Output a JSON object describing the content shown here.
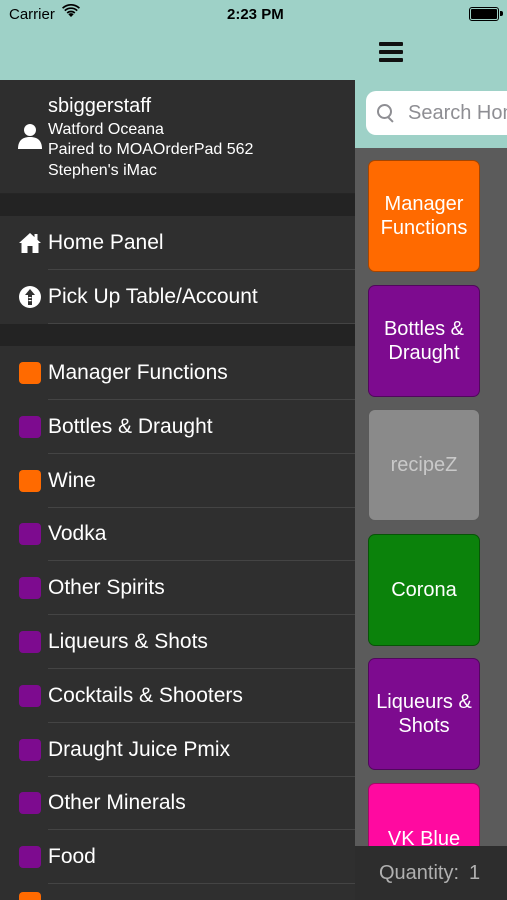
{
  "status_bar": {
    "carrier": "Carrier",
    "time": "2:23 PM"
  },
  "profile": {
    "username": "sbiggerstaff",
    "venue": "Watford Oceana",
    "paired": "Paired to MOAOrderPad 562",
    "device": "Stephen's iMac"
  },
  "nav": [
    {
      "label": "Home Panel",
      "icon": "house-icon"
    },
    {
      "label": "Pick Up Table/Account",
      "icon": "pickup-icon"
    }
  ],
  "categories": [
    {
      "label": "Manager Functions",
      "color": "#ff6a00"
    },
    {
      "label": "Bottles & Draught",
      "color": "#7d0b8f"
    },
    {
      "label": "Wine",
      "color": "#ff6a00"
    },
    {
      "label": "Vodka",
      "color": "#7d0b8f"
    },
    {
      "label": "Other Spirits",
      "color": "#7d0b8f"
    },
    {
      "label": "Liqueurs & Shots",
      "color": "#7d0b8f"
    },
    {
      "label": "Cocktails & Shooters",
      "color": "#7d0b8f"
    },
    {
      "label": "Draught Juice Pmix",
      "color": "#7d0b8f"
    },
    {
      "label": "Other Minerals",
      "color": "#7d0b8f"
    },
    {
      "label": "Food",
      "color": "#7d0b8f"
    }
  ],
  "search": {
    "placeholder": "Search Home"
  },
  "tiles": [
    {
      "label": "Manager Functions",
      "color": "#ff6a00",
      "dim": false
    },
    {
      "label": "Bottles & Draught",
      "color": "#7d0b8f",
      "dim": false
    },
    {
      "label": "recipeZ",
      "color": "#8a8a8a",
      "dim": true
    },
    {
      "label": "Corona",
      "color": "#0b820b",
      "dim": false
    },
    {
      "label": "Liqueurs & Shots",
      "color": "#7d0b8f",
      "dim": false
    },
    {
      "label": "VK Blue",
      "color": "#ff0aa0",
      "dim": false
    }
  ],
  "quantity": {
    "label": "Quantity:",
    "value": "1"
  }
}
